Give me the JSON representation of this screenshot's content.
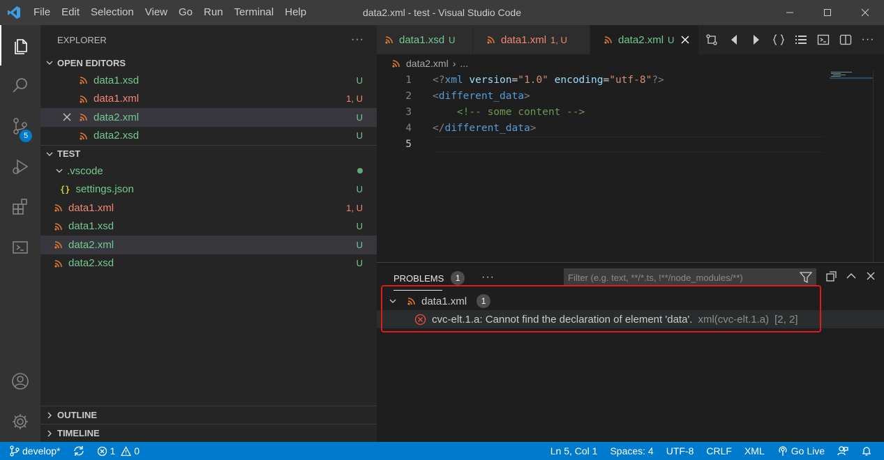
{
  "titlebar": {
    "menu": [
      "File",
      "Edit",
      "Selection",
      "View",
      "Go",
      "Run",
      "Terminal",
      "Help"
    ],
    "window_title": "data2.xml - test - Visual Studio Code"
  },
  "activitybar": {
    "items": [
      "explorer-icon",
      "search-icon",
      "source-control-icon",
      "run-debug-icon",
      "extensions-icon",
      "remote-explorer-icon"
    ],
    "scm_badge": "5",
    "bottom": [
      "accounts-icon",
      "settings-gear-icon"
    ]
  },
  "explorer": {
    "header": "EXPLORER",
    "more": "···",
    "open_editors": {
      "title": "OPEN EDITORS",
      "items": [
        {
          "name": "data1.xsd",
          "status": "U",
          "color": "green"
        },
        {
          "name": "data1.xml",
          "status": "1, U",
          "color": "red"
        },
        {
          "name": "data2.xml",
          "status": "U",
          "color": "green"
        },
        {
          "name": "data2.xsd",
          "status": "U",
          "color": "green"
        }
      ]
    },
    "workspace": {
      "title": "TEST",
      "folder": ".vscode",
      "settings": {
        "icon": "{}",
        "name": "settings.json",
        "status": "U"
      },
      "files": [
        {
          "name": "data1.xml",
          "status": "1, U",
          "color": "red"
        },
        {
          "name": "data1.xsd",
          "status": "U",
          "color": "green"
        },
        {
          "name": "data2.xml",
          "status": "U",
          "color": "green"
        },
        {
          "name": "data2.xsd",
          "status": "U",
          "color": "green"
        }
      ]
    },
    "outline": "OUTLINE",
    "timeline": "TIMELINE"
  },
  "tabs": [
    {
      "name": "data1.xsd",
      "status": "U"
    },
    {
      "name": "data1.xml",
      "status": "1, U"
    },
    {
      "name": "data2.xml",
      "status": "U"
    }
  ],
  "breadcrumb": {
    "file": "data2.xml",
    "sep": "›",
    "rest": "..."
  },
  "editor": {
    "line_numbers": [
      "1",
      "2",
      "3",
      "4",
      "5"
    ],
    "l1": {
      "open": "<?",
      "xml": "xml",
      "attr1": " version",
      "eq1": "=",
      "val1": "\"1.0\"",
      "attr2": " encoding",
      "eq2": "=",
      "val2": "\"utf-8\"",
      "close": "?>"
    },
    "l2": {
      "lt": "<",
      "tag": "different_data",
      "gt": ">"
    },
    "l3": {
      "comment": "    <!-- some content -->"
    },
    "l4": {
      "lt": "</",
      "tag": "different_data",
      "gt": ">"
    }
  },
  "panel": {
    "tab": "PROBLEMS",
    "count": "1",
    "more": "···",
    "filter_placeholder": "Filter (e.g. text, **/*.ts, !**/node_modules/**)",
    "file": {
      "name": "data1.xml",
      "count": "1"
    },
    "problem": {
      "message": "cvc-elt.1.a: Cannot find the declaration of element 'data'.",
      "source": "xml(cvc-elt.1.a)",
      "position": "[2, 2]"
    }
  },
  "statusbar": {
    "branch": "develop*",
    "errors": "1",
    "warnings": "0",
    "position": "Ln 5, Col 1",
    "spaces": "Spaces: 4",
    "encoding": "UTF-8",
    "eol": "CRLF",
    "language": "XML",
    "golive": "Go Live"
  },
  "colors": {
    "accent": "#007acc",
    "untracked": "#73c991",
    "error": "#f48771",
    "highlight": "#e01919"
  }
}
